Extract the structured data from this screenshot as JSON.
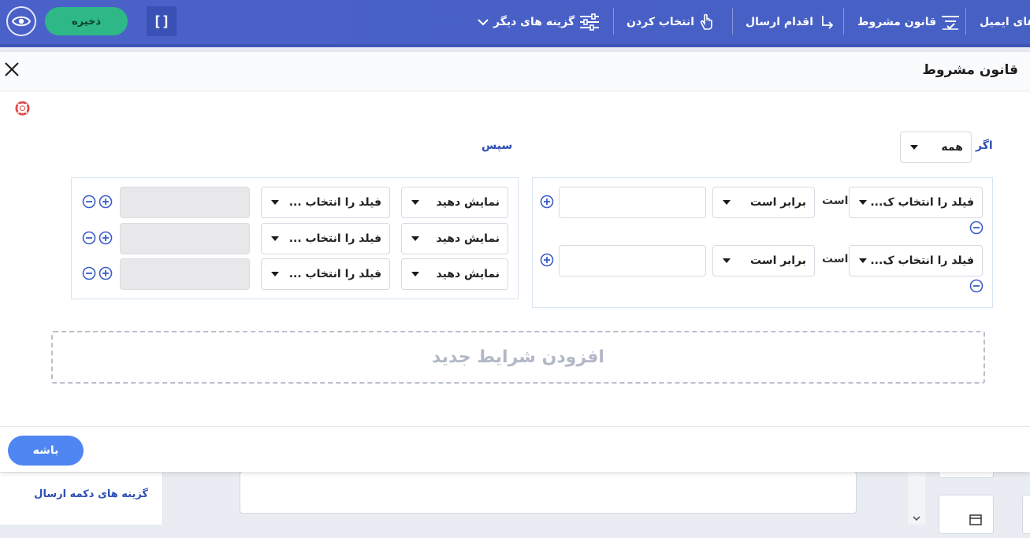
{
  "toolbar": {
    "save_label": "ذخیره",
    "bracket_label": "[]",
    "more_options_label": "گزینه های دیگر",
    "select_label": "انتخاب کردن",
    "submit_action_label": "اقدام ارسال",
    "conditional_rule_label": "قانون مشروط",
    "email_label": "های ایمیل"
  },
  "modal": {
    "title": "قانون مشروط",
    "if_label": "اگر",
    "if_match_value": "همه",
    "then_label": "سپس",
    "conditions": [
      {
        "field_placeholder": "فیلد را انتخاب ک...",
        "is_label": "است",
        "operator": "برابر است",
        "value": ""
      },
      {
        "field_placeholder": "فیلد را انتخاب ک...",
        "is_label": "است",
        "operator": "برابر است",
        "value": ""
      }
    ],
    "actions": [
      {
        "action": "نمایش دهید",
        "field_placeholder": "فیلد را انتخاب ..."
      },
      {
        "action": "نمایش دهید",
        "field_placeholder": "فیلد را انتخاب ..."
      },
      {
        "action": "نمایش دهید",
        "field_placeholder": "فیلد را انتخاب ..."
      }
    ],
    "add_condition_label": "افزودن شرایط جدید",
    "ok_label": "باشه"
  },
  "background": {
    "sidebar_label": "گزینه های دکمه ارسال"
  },
  "colors": {
    "toolbar_bg": "#4a61c9",
    "save_bg": "#2eb887",
    "accent_blue": "#2d4fb5",
    "ok_bg": "#4f86f2",
    "help_red": "#e04a4a"
  }
}
